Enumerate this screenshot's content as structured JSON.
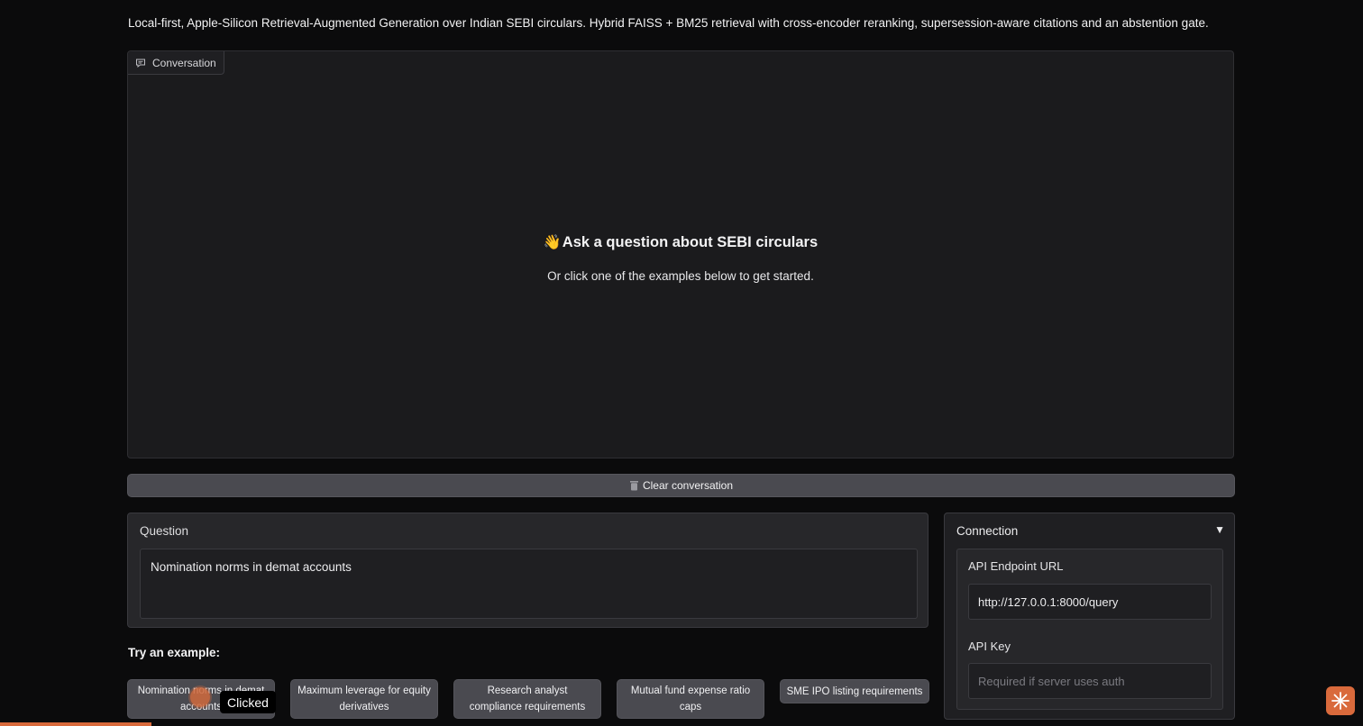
{
  "description": "Local-first, Apple-Silicon Retrieval-Augmented Generation over Indian SEBI circulars. Hybrid FAISS + BM25 retrieval with cross-encoder reranking, supersession-aware citations and an abstention gate.",
  "chat": {
    "label": "Conversation",
    "label_icon": "chat-bubble-icon",
    "empty_icon": "waving-hand-icon",
    "empty_title": "Ask a question about SEBI circulars",
    "empty_subtitle": "Or click one of the examples below to get started."
  },
  "clear_button": {
    "icon": "trash-icon",
    "label": "Clear conversation"
  },
  "question": {
    "label": "Question",
    "value": "Nomination norms in demat accounts"
  },
  "examples": {
    "heading": "Try an example:",
    "items": [
      "Nomination norms in demat accounts",
      "Maximum leverage for equity derivatives",
      "Research analyst compliance requirements",
      "Mutual fund expense ratio caps",
      "SME IPO listing requirements"
    ]
  },
  "click_indicator": {
    "label": "Clicked"
  },
  "connection": {
    "title": "Connection",
    "toggle_icon": "triangle-down-icon",
    "endpoint_label": "API Endpoint URL",
    "endpoint_value": "http://127.0.0.1:8000/query",
    "key_label": "API Key",
    "key_placeholder": "Required if server uses auth"
  },
  "colors": {
    "accent": "#d96a3c",
    "background": "#0b0b0c",
    "panel": "#1b1b1d",
    "button": "#4a4a50"
  }
}
